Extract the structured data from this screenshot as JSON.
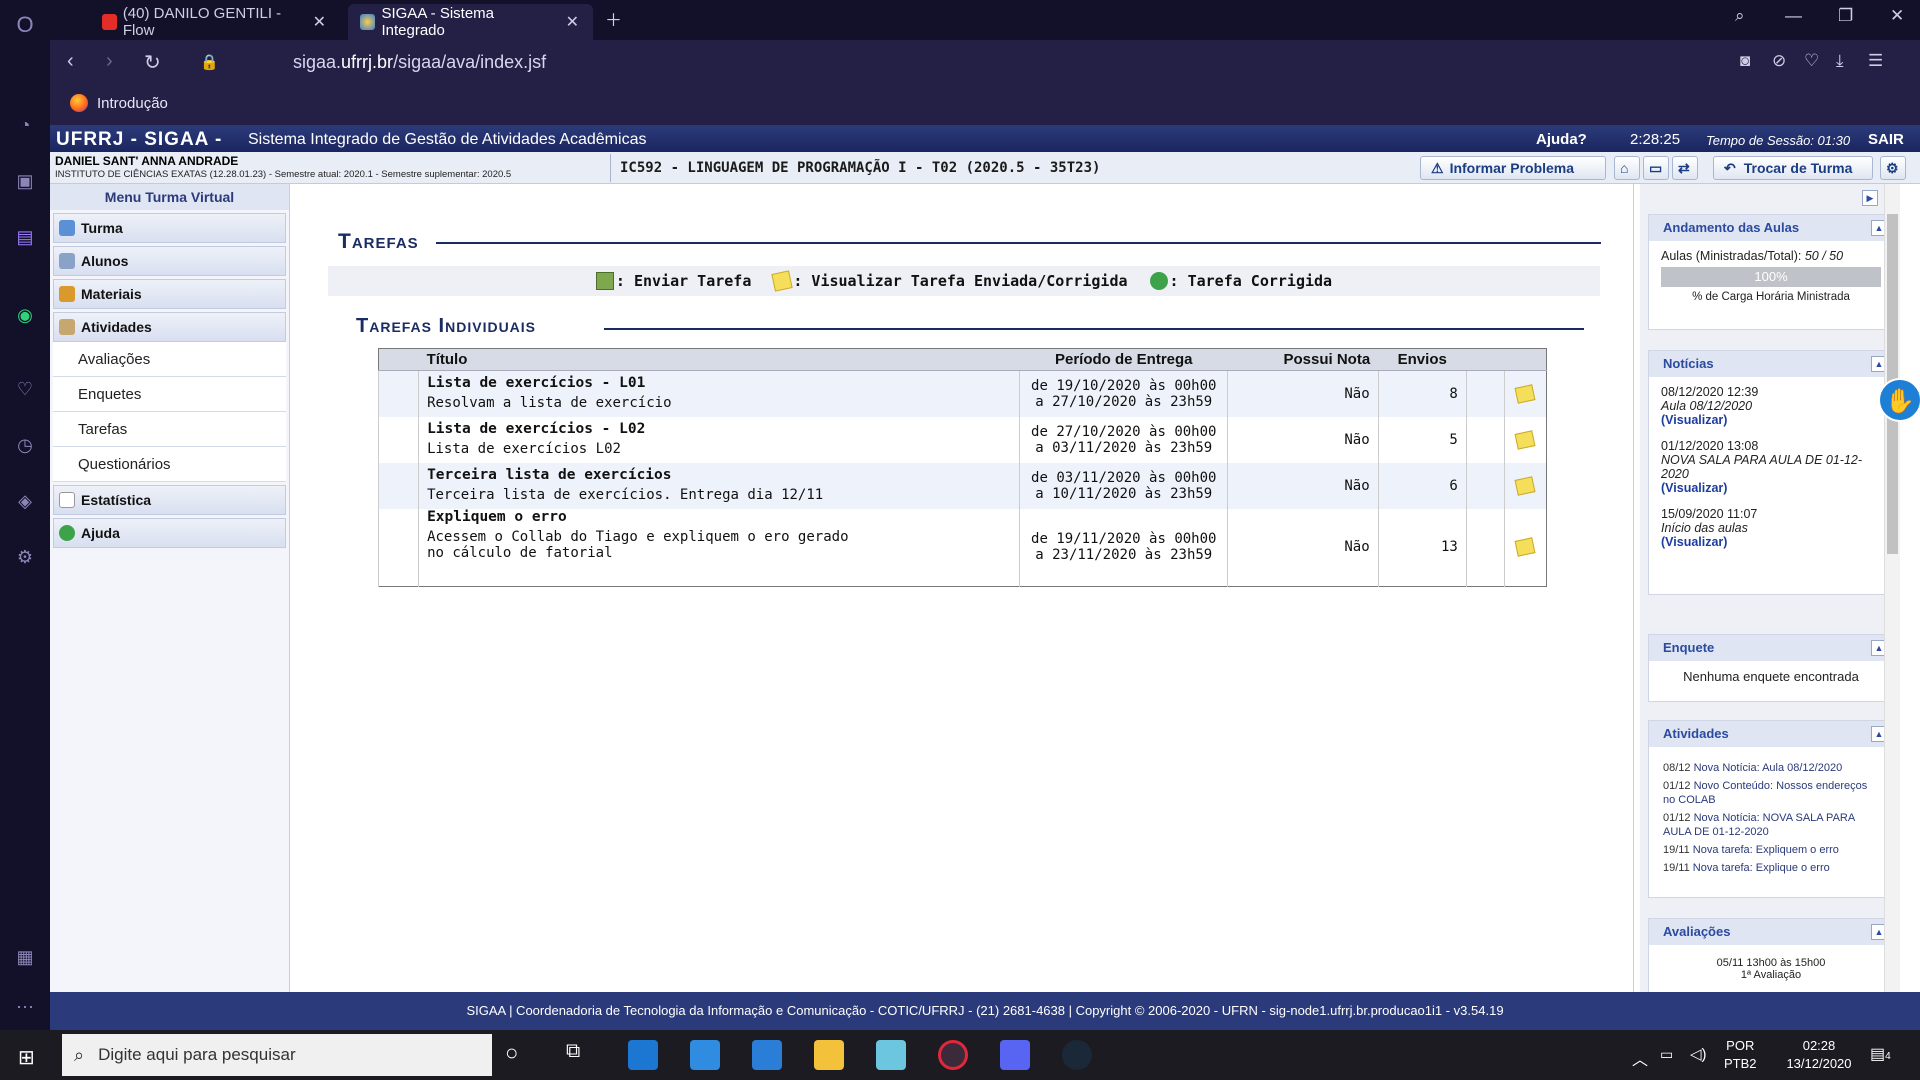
{
  "browser": {
    "tabs": [
      {
        "title": "(40) DANILO GENTILI - Flow"
      },
      {
        "title": "SIGAA - Sistema Integrado"
      }
    ],
    "url_prefix": "sigaa.",
    "url_domain": "ufrrj.br",
    "url_path": "/sigaa/ava/index.jsf",
    "bookmark": "Introdução"
  },
  "header": {
    "brand": "UFRRJ - SIGAA -",
    "subtitle": "Sistema Integrado de Gestão de Atividades Acadêmicas",
    "help": "Ajuda?",
    "clock": "2:28:25",
    "session": "Tempo de Sessão: 01:30",
    "logout": "SAIR"
  },
  "userbar": {
    "name": "DANIEL SANT' ANNA ANDRADE",
    "institute": "INSTITUTO DE CIÊNCIAS EXATAS (12.28.01.23) - Semestre atual: 2020.1 - Semestre suplementar: 2020.5",
    "course": "IC592 - LINGUAGEM DE PROGRAMAÇÃO I - T02 (2020.5 - 35T23)",
    "report_problem": "Informar Problema",
    "change_class": "Trocar de Turma"
  },
  "menu": {
    "title": "Menu Turma Virtual",
    "items": [
      "Turma",
      "Alunos",
      "Materiais",
      "Atividades"
    ],
    "subitems": [
      "Avaliações",
      "Enquetes",
      "Tarefas",
      "Questionários"
    ],
    "items_after": [
      "Estatística",
      "Ajuda"
    ]
  },
  "main": {
    "title": "Tarefas",
    "legend": {
      "send": ": Enviar Tarefa",
      "view": ": Visualizar Tarefa Enviada/Corrigida",
      "corrected": ": Tarefa Corrigida"
    },
    "subtitle": "Tarefas Individuais",
    "columns": [
      "Título",
      "Período de Entrega",
      "Possui Nota",
      "Envios"
    ],
    "rows": [
      {
        "title": "Lista de exercícios - L01",
        "desc": "Resolvam a lista de exercício",
        "start": "de 19/10/2020 às 00h00",
        "end": "a 27/10/2020 às 23h59",
        "grade": "Não",
        "sent": "8"
      },
      {
        "title": "Lista de exercícios - L02",
        "desc": "Lista de exercícios L02",
        "start": "de 27/10/2020 às 00h00",
        "end": "a 03/11/2020 às 23h59",
        "grade": "Não",
        "sent": "5"
      },
      {
        "title": "Terceira lista de exercícios",
        "desc": "Terceira lista de exercícios. Entrega dia 12/11",
        "start": "de 03/11/2020 às 00h00",
        "end": "a 10/11/2020 às 23h59",
        "grade": "Não",
        "sent": "6"
      },
      {
        "title": "Expliquem o erro",
        "desc": "Acessem o Collab do Tiago e expliquem o ero gerado",
        "desc2": "no cálculo de fatorial",
        "start": "de 19/11/2020 às 00h00",
        "end": "a 23/11/2020 às 23h59",
        "grade": "Não",
        "sent": "13"
      }
    ]
  },
  "right": {
    "progress": {
      "title": "Andamento das Aulas",
      "label": "Aulas (Ministradas/Total):",
      "value": "50 / 50",
      "percent": "100%",
      "caption": "% de Carga Horária Ministrada"
    },
    "news": {
      "title": "Notícias",
      "items": [
        {
          "date": "08/12/2020 12:39",
          "text": "Aula 08/12/2020",
          "link": "(Visualizar)"
        },
        {
          "date": "01/12/2020 13:08",
          "text": "NOVA SALA PARA AULA DE 01-12-2020",
          "link": "(Visualizar)"
        },
        {
          "date": "15/09/2020 11:07",
          "text": "Início das aulas",
          "link": "(Visualizar)"
        }
      ]
    },
    "poll": {
      "title": "Enquete",
      "text": "Nenhuma enquete encontrada"
    },
    "activities": {
      "title": "Atividades",
      "items": [
        {
          "date": "08/12",
          "text": "Nova Notícia: Aula 08/12/2020"
        },
        {
          "date": "01/12",
          "text": "Novo Conteúdo: Nossos endereços no COLAB"
        },
        {
          "date": "01/12",
          "text": "Nova Notícia: NOVA SALA PARA AULA DE 01-12-2020"
        },
        {
          "date": "19/11",
          "text": "Nova tarefa: Expliquem o erro"
        },
        {
          "date": "19/11",
          "text": "Nova tarefa: Explique o erro"
        }
      ]
    },
    "evaluations": {
      "title": "Avaliações",
      "item": "05/11 13h00 às 15h00",
      "item2": "1ª Avaliação"
    }
  },
  "footer": "SIGAA | Coordenadoria de Tecnologia da Informação e Comunicação - COTIC/UFRRJ - (21) 2681-4638 | Copyright © 2006-2020 - UFRN - sig-node1.ufrrj.br.producao1i1 - v3.54.19",
  "taskbar": {
    "search_placeholder": "Digite aqui para pesquisar",
    "lang1": "POR",
    "lang2": "PTB2",
    "time": "02:28",
    "date": "13/12/2020",
    "notif": "4"
  }
}
